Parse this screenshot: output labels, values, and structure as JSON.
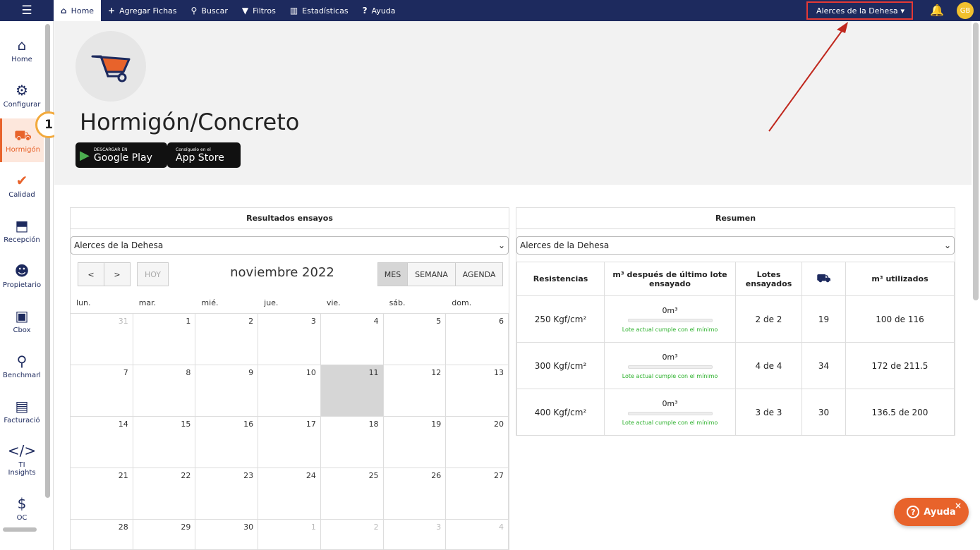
{
  "topbar": {
    "nav": [
      {
        "label": "Home",
        "icon": "home-icon"
      },
      {
        "label": "Agregar Fichas",
        "icon": "plus-icon"
      },
      {
        "label": "Buscar",
        "icon": "search-icon"
      },
      {
        "label": "Filtros",
        "icon": "filter-icon"
      },
      {
        "label": "Estadísticas",
        "icon": "chart-icon"
      },
      {
        "label": "Ayuda",
        "icon": "question-icon"
      }
    ],
    "project": "Alerces de la Dehesa",
    "avatar": "GB",
    "bar_color": "#1d2a5e"
  },
  "sidebar": {
    "items": [
      {
        "label": "Home",
        "icon": "home-icon"
      },
      {
        "label": "Configurar",
        "icon": "gear-icon"
      },
      {
        "label": "Hormigón",
        "icon": "wheelbarrow-icon"
      },
      {
        "label": "Calidad",
        "icon": "quality-icon"
      },
      {
        "label": "Recepción",
        "icon": "reception-icon"
      },
      {
        "label": "Propietario",
        "icon": "owner-icon"
      },
      {
        "label": "Cbox",
        "icon": "cbox-icon"
      },
      {
        "label": "Benchmarl",
        "icon": "benchmark-icon"
      },
      {
        "label": "Facturació",
        "icon": "billing-icon"
      },
      {
        "label": "TI Insights",
        "icon": "code-icon"
      },
      {
        "label": "OC",
        "icon": "dollar-icon"
      }
    ],
    "active_color": "#e8632b"
  },
  "step_badge": "1",
  "hero": {
    "title": "Hormigón/Concreto",
    "google_play": {
      "small": "DESCARGAR EN",
      "big": "Google Play"
    },
    "app_store": {
      "small": "Consíguelo en el",
      "big": "App Store"
    }
  },
  "calendar": {
    "header": "Resultados ensayos",
    "select": "Alerces de la Dehesa",
    "prev": "<",
    "next": ">",
    "today": "HOY",
    "title": "noviembre 2022",
    "views": [
      "MES",
      "SEMANA",
      "AGENDA"
    ],
    "weekdays": [
      "lun.",
      "mar.",
      "mié.",
      "jue.",
      "vie.",
      "sáb.",
      "dom."
    ],
    "days": [
      {
        "d": "31",
        "other": true
      },
      {
        "d": "1"
      },
      {
        "d": "2"
      },
      {
        "d": "3"
      },
      {
        "d": "4"
      },
      {
        "d": "5"
      },
      {
        "d": "6"
      },
      {
        "d": "7"
      },
      {
        "d": "8"
      },
      {
        "d": "9"
      },
      {
        "d": "10"
      },
      {
        "d": "11",
        "today": true
      },
      {
        "d": "12"
      },
      {
        "d": "13"
      },
      {
        "d": "14"
      },
      {
        "d": "15"
      },
      {
        "d": "16"
      },
      {
        "d": "17"
      },
      {
        "d": "18"
      },
      {
        "d": "19"
      },
      {
        "d": "20"
      },
      {
        "d": "21"
      },
      {
        "d": "22"
      },
      {
        "d": "23"
      },
      {
        "d": "24"
      },
      {
        "d": "25"
      },
      {
        "d": "26"
      },
      {
        "d": "27"
      },
      {
        "d": "28"
      },
      {
        "d": "29"
      },
      {
        "d": "30"
      },
      {
        "d": "1",
        "other": true
      },
      {
        "d": "2",
        "other": true
      },
      {
        "d": "3",
        "other": true
      },
      {
        "d": "4",
        "other": true
      }
    ]
  },
  "resumen": {
    "header": "Resumen",
    "select": "Alerces de la Dehesa",
    "columns": [
      "Resistencias",
      "m³ después de último lote ensayado",
      "Lotes ensayados",
      "wheelbarrow-icon",
      "m³ utilizados"
    ],
    "rows": [
      {
        "res": "250 Kgf/cm²",
        "m3": "0m³",
        "progress": 0,
        "msg": "Lote actual cumple con el mínimo",
        "lotes": "2 de 2",
        "count": "19",
        "used": "100 de 116"
      },
      {
        "res": "300 Kgf/cm²",
        "m3": "0m³",
        "progress": 0,
        "msg": "Lote actual cumple con el mínimo",
        "lotes": "4 de 4",
        "count": "34",
        "used": "172 de 211.5"
      },
      {
        "res": "400 Kgf/cm²",
        "m3": "0m³",
        "progress": 0,
        "msg": "Lote actual cumple con el mínimo",
        "lotes": "3 de 3",
        "count": "30",
        "used": "136.5 de 200"
      }
    ]
  },
  "help": {
    "label": "Ayuda",
    "close": "×"
  }
}
